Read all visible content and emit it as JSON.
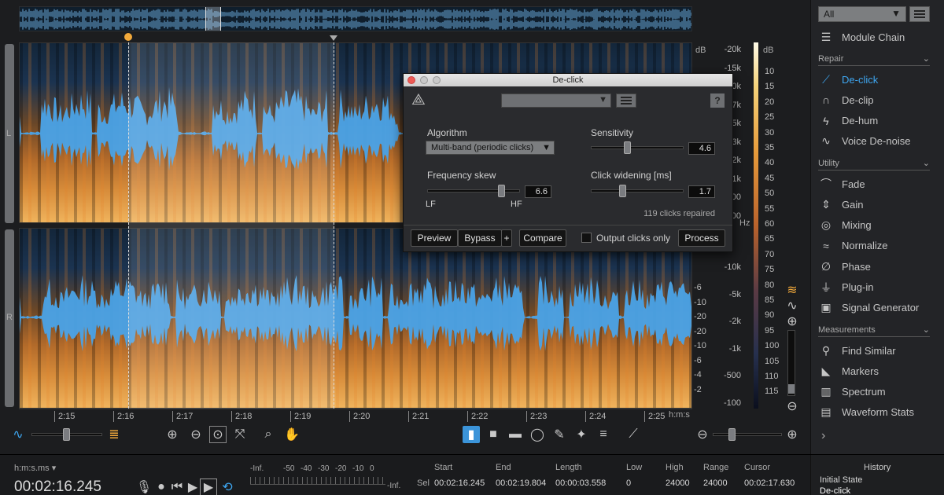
{
  "overview": {
    "label": ""
  },
  "tracks": {
    "left_label": "L",
    "right_label": "R"
  },
  "freq_scale_top": [
    "-20k",
    "-15k",
    "-10k",
    "-7k",
    "-5k",
    "-3k",
    "-2k",
    "-1k",
    "-500",
    "-100"
  ],
  "freq_scale_bottom": [
    "-10k",
    "-5k",
    "-2k",
    "-1k",
    "-500",
    "-100"
  ],
  "amp_scale_bottom": [
    "-6",
    "-10",
    "-20",
    "-20",
    "-10",
    "-6",
    "-4",
    "-2"
  ],
  "scale_units": {
    "left_db": "dB",
    "hz": "Hz",
    "right_db": "dB"
  },
  "db_scale": [
    "10",
    "15",
    "20",
    "25",
    "30",
    "35",
    "40",
    "45",
    "50",
    "55",
    "60",
    "65",
    "70",
    "75",
    "80",
    "85",
    "90",
    "95",
    "100",
    "105",
    "110",
    "115"
  ],
  "timeline": {
    "ticks": [
      "2:15",
      "2:16",
      "2:17",
      "2:18",
      "2:19",
      "2:20",
      "2:21",
      "2:22",
      "2:23",
      "2:24",
      "2:25"
    ],
    "unit": "h:m:s"
  },
  "dialog": {
    "title": "De-click",
    "help": "?",
    "algorithm_label": "Algorithm",
    "algorithm_value": "Multi-band (periodic clicks)",
    "sensitivity_label": "Sensitivity",
    "sensitivity_value": "4.6",
    "sensitivity_level": 0.38,
    "frequency_skew_label": "Frequency skew",
    "frequency_skew_value": "6.6",
    "frequency_skew_level": 0.82,
    "lf_label": "LF",
    "hf_label": "HF",
    "click_widening_label": "Click widening [ms]",
    "click_widening_value": "1.7",
    "click_widening_level": 0.32,
    "clicks_repaired": "119 clicks repaired",
    "preview": "Preview",
    "bypass": "Bypass",
    "plus": "+",
    "compare": "Compare",
    "output_clicks_only": "Output clicks only",
    "process": "Process"
  },
  "right_panel": {
    "filter": "All",
    "module_chain": "Module Chain",
    "sections": {
      "repair": "Repair",
      "utility": "Utility",
      "measurements": "Measurements"
    },
    "repair_items": [
      "De-click",
      "De-clip",
      "De-hum",
      "Voice De-noise"
    ],
    "utility_items": [
      "Fade",
      "Gain",
      "Mixing",
      "Normalize",
      "Phase",
      "Plug-in",
      "Signal Generator"
    ],
    "measurement_items": [
      "Find Similar",
      "Markers",
      "Spectrum",
      "Waveform Stats"
    ]
  },
  "bottom": {
    "time_format": "h:m:s.ms",
    "time_value": "00:02:16.245",
    "meter_labels": [
      "-Inf.",
      "-50",
      "-40",
      "-30",
      "-20",
      "-10",
      "0"
    ],
    "meter_inf": "-Inf.",
    "sel_label": "Sel",
    "start_label": "Start",
    "start_value": "00:02:16.245",
    "end_label": "End",
    "end_value": "00:02:19.804",
    "length_label": "Length",
    "length_value": "00:00:03.558",
    "low_label": "Low",
    "low_value": "0",
    "high_label": "High",
    "high_value": "24000",
    "range_label": "Range",
    "range_value": "24000",
    "cursor_label": "Cursor",
    "cursor_value": "00:02:17.630",
    "history_label": "History",
    "history_items": [
      "Initial State",
      "De-click"
    ]
  },
  "colors": {
    "accent": "#3ea6f0",
    "waveform": "#4aa3e8",
    "playhead": "#f2a93b"
  }
}
